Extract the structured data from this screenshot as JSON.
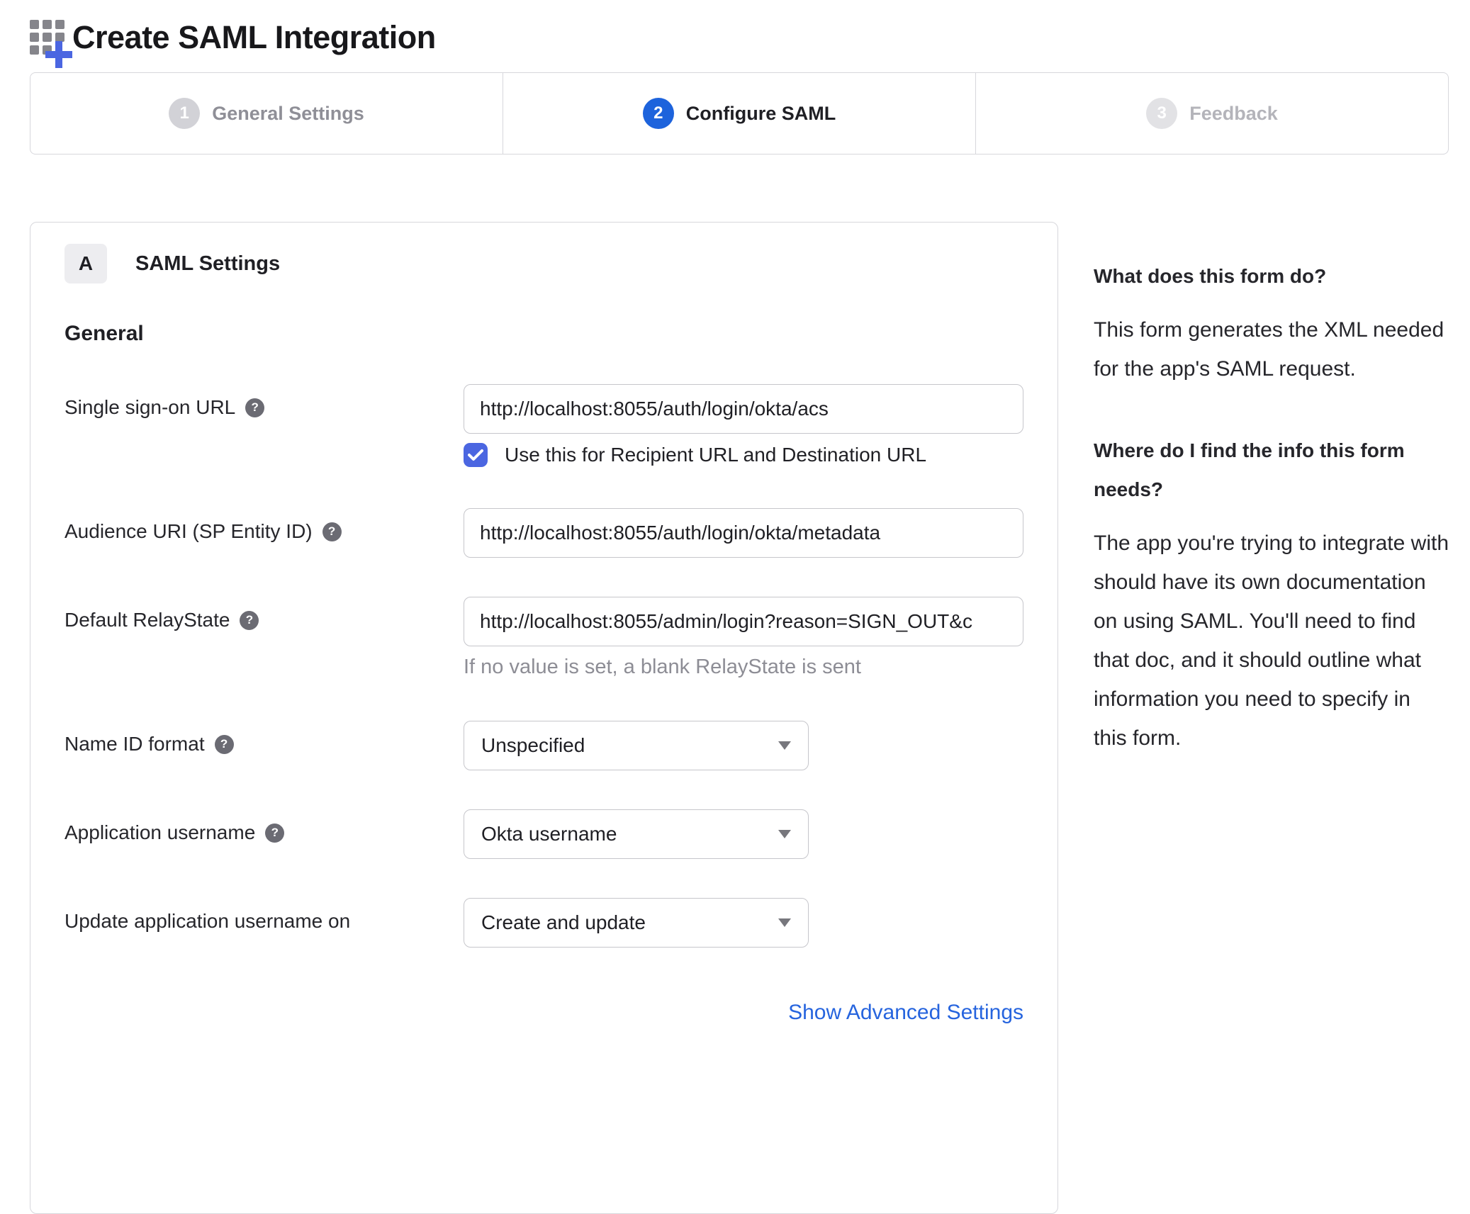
{
  "page": {
    "title": "Create SAML Integration"
  },
  "stepper": {
    "steps": [
      {
        "number": "1",
        "label": "General Settings",
        "state": "completed"
      },
      {
        "number": "2",
        "label": "Configure SAML",
        "state": "active"
      },
      {
        "number": "3",
        "label": "Feedback",
        "state": "upcoming"
      }
    ]
  },
  "form": {
    "section_badge": "A",
    "section_title": "SAML Settings",
    "group_title": "General",
    "help_icon_glyph": "?",
    "fields": {
      "sso_url": {
        "label": "Single sign-on URL",
        "value": "http://localhost:8055/auth/login/okta/acs",
        "checkbox_label": "Use this for Recipient URL and Destination URL",
        "checkbox_checked": true
      },
      "audience_uri": {
        "label": "Audience URI (SP Entity ID)",
        "value": "http://localhost:8055/auth/login/okta/metadata"
      },
      "default_relay_state": {
        "label": "Default RelayState",
        "value": "http://localhost:8055/admin/login?reason=SIGN_OUT&c",
        "hint": "If no value is set, a blank RelayState is sent"
      },
      "name_id_format": {
        "label": "Name ID format",
        "value": "Unspecified"
      },
      "application_username": {
        "label": "Application username",
        "value": "Okta username"
      },
      "update_application_username_on": {
        "label": "Update application username on",
        "value": "Create and update"
      }
    },
    "advanced_link": "Show Advanced Settings"
  },
  "help_panel": {
    "sections": [
      {
        "heading": "What does this form do?",
        "body": "This form generates the XML needed for the app's SAML request."
      },
      {
        "heading": "Where do I find the info this form needs?",
        "body": "The app you're trying to integrate with should have its own documentation on using SAML. You'll need to find that doc, and it should outline what information you need to specify in this form."
      }
    ]
  },
  "appearance": {
    "accent_blue": "#1d63dc",
    "link_blue": "#2664de",
    "checkbox_blue": "#4b66e1",
    "border_gray": "#d7d7dc",
    "muted_text": "#8d8d95"
  }
}
